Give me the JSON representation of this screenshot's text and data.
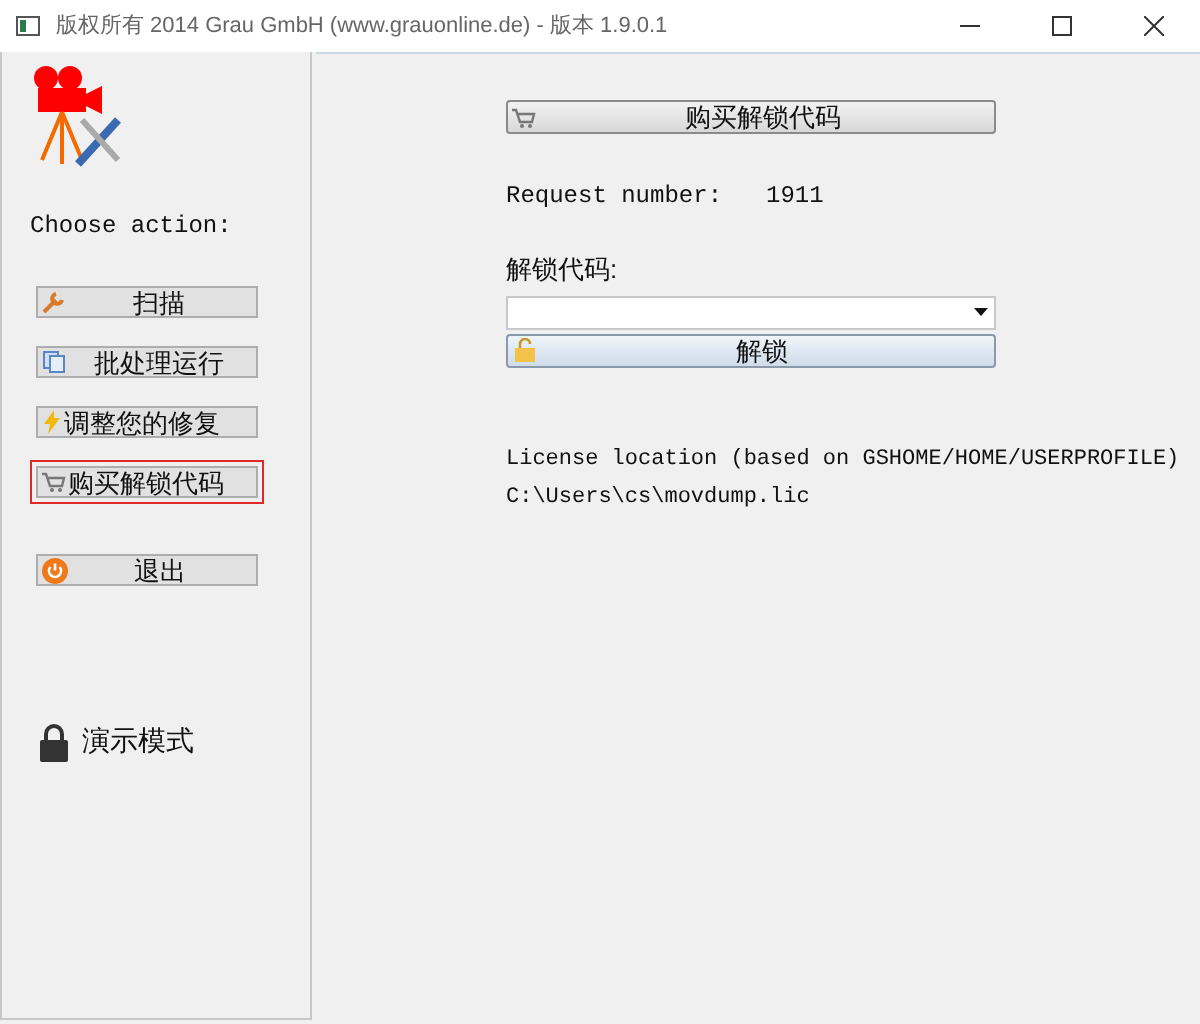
{
  "window": {
    "title": "版权所有 2014 Grau GmbH (www.grauonline.de) - 版本 1.9.0.1"
  },
  "sidebar": {
    "heading": "Choose action:",
    "actions": [
      {
        "label": "扫描",
        "kind": "scan",
        "selected": false
      },
      {
        "label": "批处理运行",
        "kind": "batch",
        "selected": false
      },
      {
        "label": "调整您的修复",
        "kind": "adjust",
        "selected": false
      },
      {
        "label": "购买解锁代码",
        "kind": "buy",
        "selected": true
      },
      {
        "label": "退出",
        "kind": "exit",
        "selected": false
      }
    ],
    "mode": "演示模式"
  },
  "main": {
    "buy_button": "购买解锁代码",
    "request_label": "Request number:",
    "request_number": "1911",
    "code_label": "解锁代码:",
    "unlock_button": "解锁",
    "license_label": "License location (based on GSHOME/HOME/USERPROFILE)",
    "license_path": "C:\\Users\\cs\\movdump.lic"
  }
}
